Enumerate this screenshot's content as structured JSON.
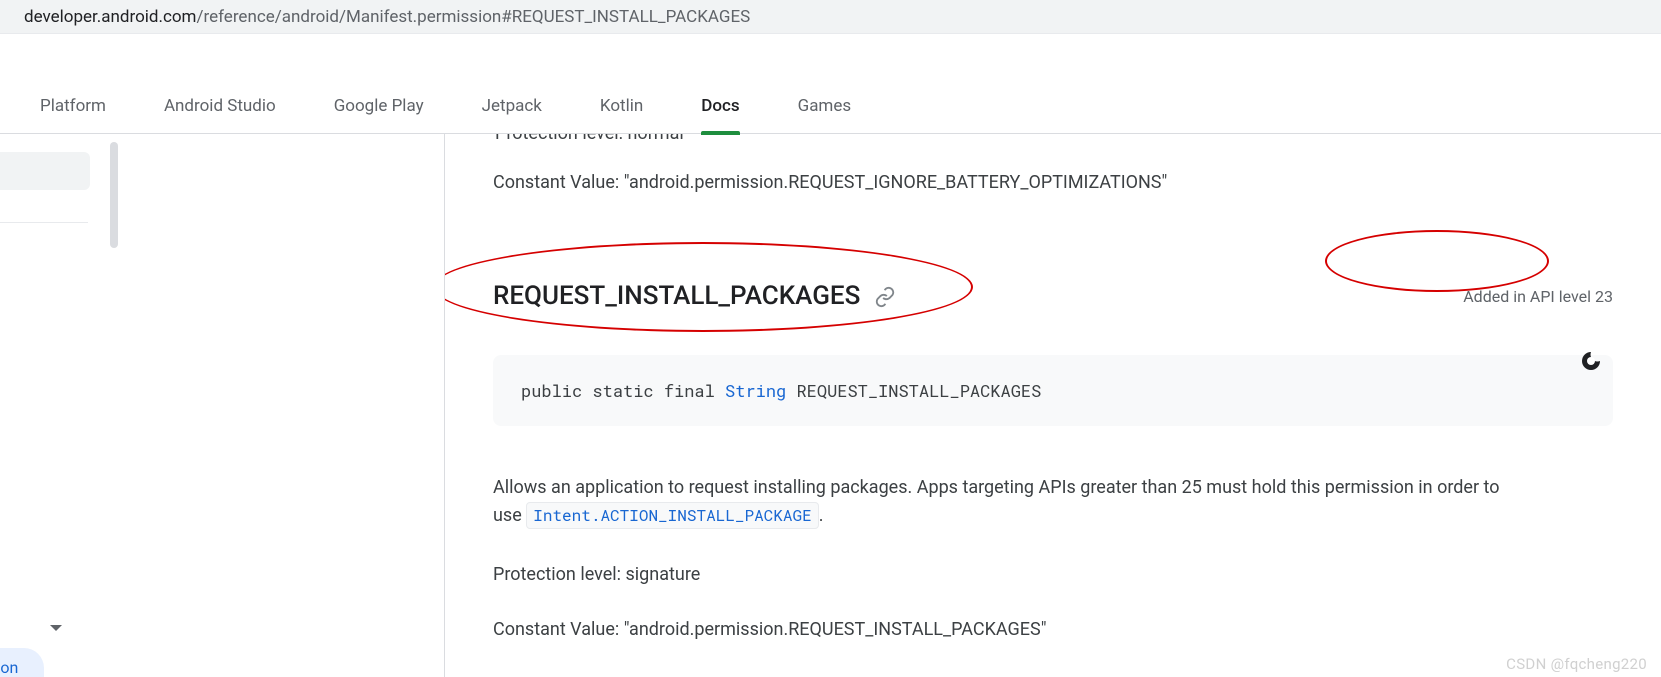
{
  "url": {
    "domain": "developer.android.com",
    "path": "/reference/android/Manifest.permission#REQUEST_INSTALL_PACKAGES"
  },
  "tabs": [
    {
      "label": "Platform"
    },
    {
      "label": "Android Studio"
    },
    {
      "label": "Google Play"
    },
    {
      "label": "Jetpack"
    },
    {
      "label": "Kotlin"
    },
    {
      "label": "Docs",
      "active": true
    },
    {
      "label": "Games"
    }
  ],
  "prev_section": {
    "protection_level_cut": "Protection level: normal",
    "constant_value": "Constant Value: \"android.permission.REQUEST_IGNORE_BATTERY_OPTIMIZATIONS\""
  },
  "section": {
    "heading": "REQUEST_INSTALL_PACKAGES",
    "api_level": "Added in API level 23",
    "code": {
      "modifiers": "public static final ",
      "type": "String",
      "name": " REQUEST_INSTALL_PACKAGES"
    },
    "description_pre": "Allows an application to request installing packages. Apps targeting APIs greater than 25 must hold this permission in order to use ",
    "description_code": "Intent.ACTION_INSTALL_PACKAGE",
    "description_post": ".",
    "protection_level": "Protection level: signature",
    "constant_value": "Constant Value: \"android.permission.REQUEST_INSTALL_PACKAGES\""
  },
  "sidebar_fragment": {
    "ssion_text": "ssion"
  },
  "watermark": "CSDN @fqcheng220"
}
